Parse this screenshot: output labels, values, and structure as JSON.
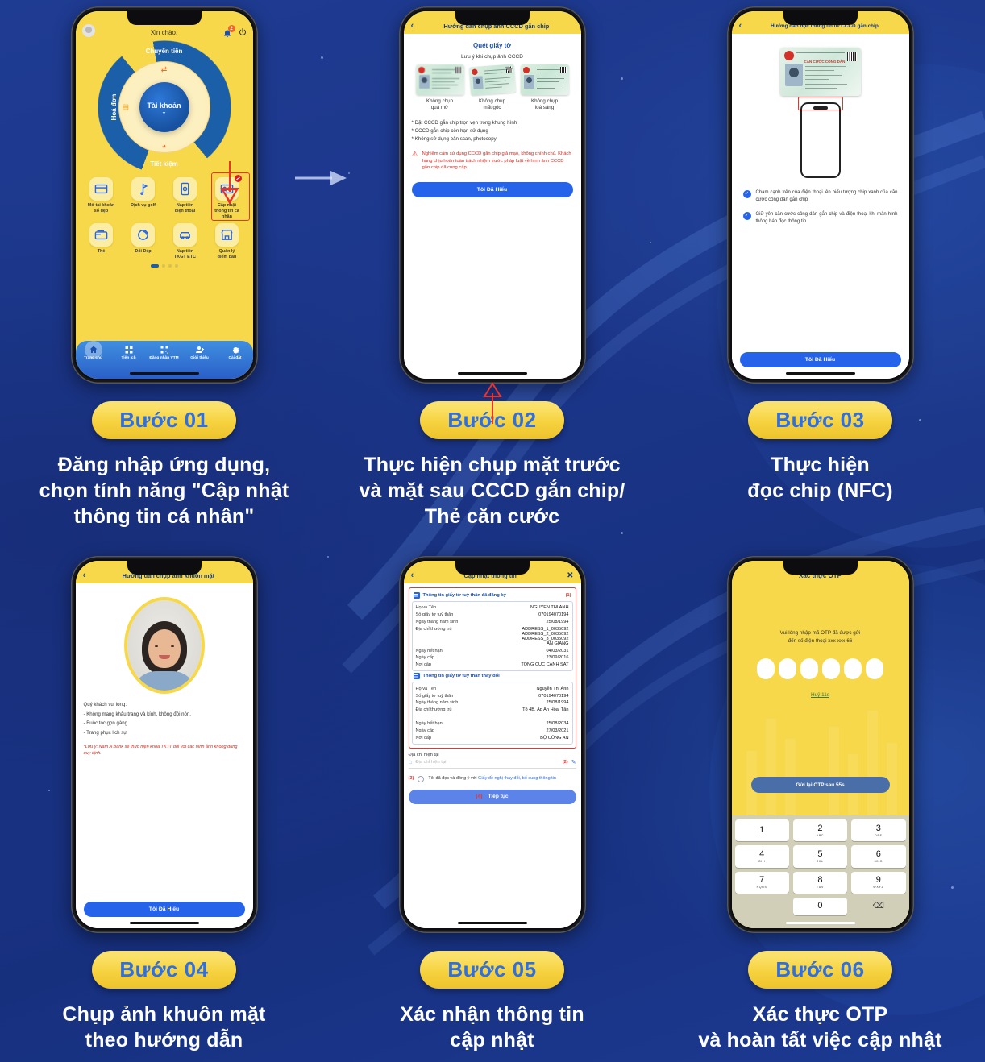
{
  "steps": [
    {
      "badge": "Bước 01",
      "caption": "Đăng nhập ứng dụng,\nchọn tính năng \"Cập nhật\nthông tin cá nhân\""
    },
    {
      "badge": "Bước 02",
      "caption": "Thực hiện chụp mặt trước\nvà mặt sau CCCD gắn chip/\nThẻ căn cước"
    },
    {
      "badge": "Bước 03",
      "caption": "Thực hiện\nđọc chip (NFC)"
    },
    {
      "badge": "Bước 04",
      "caption": "Chụp ảnh khuôn mặt\ntheo hướng dẫn"
    },
    {
      "badge": "Bước 05",
      "caption": "Xác nhận thông tin\ncập nhật"
    },
    {
      "badge": "Bước 06",
      "caption": "Xác thực OTP\nvà hoàn tất việc cập nhật"
    }
  ],
  "phone1": {
    "greeting": "Xin chào,",
    "notification_count": "2",
    "wheel": {
      "top": "Chuyển tiền",
      "left": "Hoá đơn",
      "bottom": "Tiết kiệm",
      "center": "Tài khoản"
    },
    "grid": [
      {
        "label": "Mở tài khoản\nsố đẹp",
        "icon": "card-icon"
      },
      {
        "label": "Dịch vụ golf",
        "icon": "golf-icon"
      },
      {
        "label": "Nạp tiền\nđiện thoại",
        "icon": "mobile-topup-icon"
      },
      {
        "label": "Cập nhật\nthông tin cá\nnhân",
        "icon": "id-card-icon"
      },
      {
        "label": "Thẻ",
        "icon": "wallet-icon"
      },
      {
        "label": "Đổi Dép",
        "icon": "swap-icon"
      },
      {
        "label": "Nạp tiền\nTKGT ETC",
        "icon": "car-icon"
      },
      {
        "label": "Quản lý\nđiểm bán",
        "icon": "store-icon"
      }
    ],
    "tabs": [
      {
        "label": "Trang chủ",
        "icon": "home-icon"
      },
      {
        "label": "Tiện ích",
        "icon": "grid-icon"
      },
      {
        "label": "Đăng nhập VTM",
        "icon": "qr-icon"
      },
      {
        "label": "Giới thiệu",
        "icon": "user-plus-icon"
      },
      {
        "label": "Cài đặt",
        "icon": "gear-icon"
      }
    ]
  },
  "phone2": {
    "title": "Hướng dẫn chụp ảnh CCCD gắn chip",
    "section_title": "Quét giấy tờ",
    "section_sub": "Lưu ý khi chụp ảnh CCCD",
    "cards": [
      "Không chụp\nquá mờ",
      "Không chụp\nmất góc",
      "Không chụp\nloá sáng"
    ],
    "bullets": [
      "* Đặt CCCD gắn chip trọn vẹn trong khung hình",
      "* CCCD gắn chip còn hạn sử dụng",
      "* Không sử dụng bản scan, photocopy"
    ],
    "warning": "Nghiêm cấm sử dụng CCCD gắn chip giả mạo, không chính chủ. Khách hàng chịu hoàn toàn trách nhiệm trước pháp luật về hình ảnh CCCD gắn chip đã cung cấp",
    "button": "Tôi Đã Hiểu"
  },
  "phone3": {
    "title": "Hướng dẫn đọc thông tin từ CCCD gắn chip",
    "card_label": "CĂN CƯỚC CÔNG DÂN",
    "checks": [
      "Chạm cạnh trên của điện thoại lên biểu tượng chip xanh của căn cước công dân gắn chip",
      "Giữ yên căn cước công dân gắn chip và điện thoại khi màn hình thông báo đọc thông tin"
    ],
    "button": "Tôi Đã Hiểu"
  },
  "phone4": {
    "title": "Hướng dẫn chụp ảnh khuôn mặt",
    "intro": "Quý khách vui lòng:",
    "items": [
      "- Không mang khẩu trang và kính, không đội nón.",
      "- Buộc tóc gọn gàng.",
      "- Trang phục lịch sự"
    ],
    "note": "*Lưu ý: Nam A Bank sẽ thực hiện khoá TKTT đối với các hình ảnh không đúng quy định.",
    "button": "Tôi Đã Hiểu"
  },
  "phone5": {
    "title": "Cập nhật thông tin",
    "section1": {
      "heading": "Thông tin giấy tờ tuỳ thân đã đăng ký",
      "marker": "(1)",
      "rows": [
        {
          "key": "Họ và Tên",
          "value": "NGUYEN THI ANH"
        },
        {
          "key": "Số giấy tờ tuỳ thân",
          "value": "070194070194"
        },
        {
          "key": "Ngày tháng năm sinh",
          "value": "25/08/1994"
        },
        {
          "key": "Địa chỉ thường trú",
          "value": "ADDRESS_1_0035092\nADDRESS_2_0035092\nADDRESS_3_0035092\nAN GIANG"
        },
        {
          "key": "Ngày hết hạn",
          "value": "04/03/2031"
        },
        {
          "key": "Ngày cấp",
          "value": "23/09/2016"
        },
        {
          "key": "Nơi cấp",
          "value": "TONG CUC CANH SAT"
        }
      ]
    },
    "section2": {
      "heading": "Thông tin giấy tờ tuỳ thân thay đổi",
      "rows": [
        {
          "key": "Họ và Tên",
          "value": "Nguyễn Thị Ánh"
        },
        {
          "key": "Số giấy tờ tuỳ thân",
          "value": "070194070194"
        },
        {
          "key": "Ngày tháng năm sinh",
          "value": "25/08/1994"
        },
        {
          "key": "Địa chỉ thường trú",
          "value": "Tổ 4B, Ấp An Hòa, Tân"
        },
        {
          "key": "Ngày hết hạn",
          "value": "25/08/2034"
        },
        {
          "key": "Ngày cấp",
          "value": "27/03/2021"
        },
        {
          "key": "Nơi cấp",
          "value": "BỘ CÔNG AN"
        }
      ]
    },
    "current_address_label": "Địa chỉ hiện tại",
    "current_address_placeholder": "Địa chỉ hiện tại",
    "current_address_marker": "(2)",
    "agree_marker": "(3)",
    "agree_text": "Tôi đã đọc và đồng ý với ",
    "agree_link": "Giấy đề nghị thay đổi, bổ sung thông tin",
    "submit_marker": "(4)",
    "submit": "Tiếp tục"
  },
  "phone6": {
    "title": "Xác thực OTP",
    "message": "Vui lòng nhập mã OTP đã được gửi\nđến số điện thoại xxx-xxx-66",
    "cancel": "Huỷ 11s",
    "resend": "Gửi lại OTP sau 55s",
    "keys": [
      {
        "num": "1",
        "letters": ""
      },
      {
        "num": "2",
        "letters": "ABC"
      },
      {
        "num": "3",
        "letters": "DEF"
      },
      {
        "num": "4",
        "letters": "GHI"
      },
      {
        "num": "5",
        "letters": "JKL"
      },
      {
        "num": "6",
        "letters": "MNO"
      },
      {
        "num": "7",
        "letters": "PQRS"
      },
      {
        "num": "8",
        "letters": "TUV"
      },
      {
        "num": "9",
        "letters": "WXYZ"
      },
      {
        "num": "0",
        "letters": ""
      }
    ],
    "delete_icon": "backspace-icon"
  },
  "colors": {
    "background": "#1e3a8f",
    "brand_yellow": "#f7d84a",
    "brand_blue": "#2563eb",
    "badge_text": "#2f6fe0",
    "alert_red": "#e8342a"
  }
}
